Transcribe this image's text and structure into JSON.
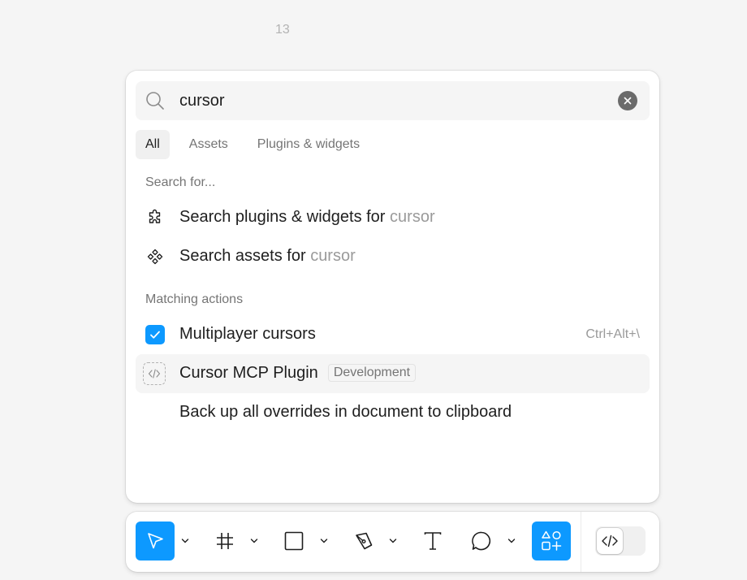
{
  "page": {
    "number": "13"
  },
  "search": {
    "value": "cursor",
    "placeholder": ""
  },
  "tabs": [
    {
      "label": "All",
      "active": true
    },
    {
      "label": "Assets",
      "active": false
    },
    {
      "label": "Plugins & widgets",
      "active": false
    }
  ],
  "search_for": {
    "heading": "Search for...",
    "items": [
      {
        "prefix": "Search plugins & widgets for ",
        "query": "cursor",
        "icon": "plugin-puzzle-icon"
      },
      {
        "prefix": "Search assets for ",
        "query": "cursor",
        "icon": "component-icon"
      }
    ]
  },
  "matching_actions": {
    "heading": "Matching actions",
    "items": [
      {
        "label": "Multiplayer cursors",
        "shortcut": "Ctrl+Alt+\\",
        "checked": true,
        "icon": "checkbox-checked-icon"
      },
      {
        "label": "Cursor MCP Plugin",
        "badge": "Development",
        "icon": "dev-plugin-code-icon",
        "highlighted": true
      },
      {
        "label": "Back up all overrides in document to clipboard"
      }
    ]
  },
  "toolbar": {
    "tools": [
      {
        "name": "move-tool",
        "icon": "cursor-arrow-icon",
        "active": true
      },
      {
        "name": "frame-tool",
        "icon": "frame-hash-icon"
      },
      {
        "name": "shape-tool",
        "icon": "rectangle-icon"
      },
      {
        "name": "pen-tool",
        "icon": "pen-icon"
      },
      {
        "name": "text-tool",
        "icon": "text-icon"
      },
      {
        "name": "comment-tool",
        "icon": "comment-bubble-icon"
      },
      {
        "name": "actions-tool",
        "icon": "actions-grid-icon",
        "active": true
      }
    ],
    "dev_mode_icon": "code-brackets-icon"
  },
  "colors": {
    "accent": "#0d99ff",
    "background": "#f5f5f5",
    "panel": "#ffffff",
    "muted_text": "#757575"
  }
}
